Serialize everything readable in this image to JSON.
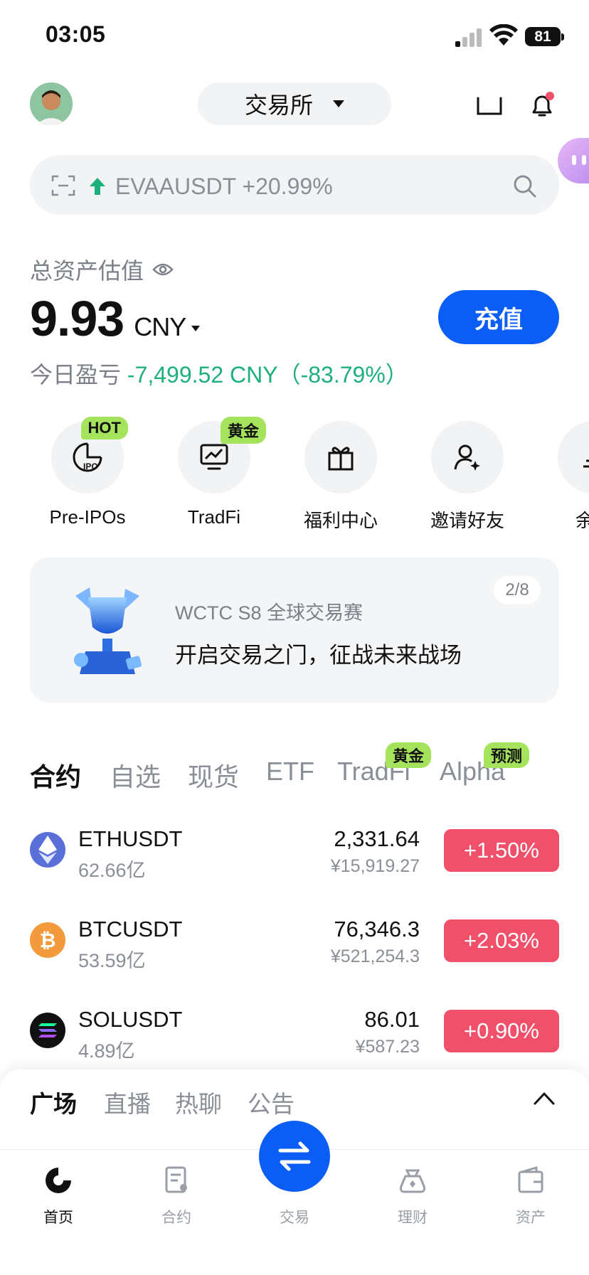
{
  "status_bar": {
    "time": "03:05",
    "battery": "81"
  },
  "header": {
    "exchange_label": "交易所"
  },
  "search": {
    "ticker": "EVAAUSDT +20.99%"
  },
  "assets": {
    "label": "总资产估值",
    "value": "9.93",
    "unit": "CNY",
    "deposit_label": "充值",
    "pnl_label": "今日盈亏",
    "pnl_value": "-7,499.52 CNY（-83.79%）"
  },
  "quick_actions": [
    {
      "label": "Pre-IPOs",
      "badge": "HOT",
      "icon": "pre-ipo-icon"
    },
    {
      "label": "TradFi",
      "badge": "黄金",
      "icon": "chart-monitor-icon"
    },
    {
      "label": "福利中心",
      "badge": "",
      "icon": "gift-icon"
    },
    {
      "label": "邀请好友",
      "badge": "",
      "icon": "invite-user-icon"
    },
    {
      "label": "余币",
      "badge": "",
      "icon": "savings-icon"
    }
  ],
  "banner": {
    "subtitle": "WCTC S8 全球交易赛",
    "title": "开启交易之门，征战未来战场",
    "pager": "2/8"
  },
  "market_tabs": [
    {
      "label": "合约",
      "badge": ""
    },
    {
      "label": "自选",
      "badge": ""
    },
    {
      "label": "现货",
      "badge": ""
    },
    {
      "label": "ETF",
      "badge": ""
    },
    {
      "label": "TradFi",
      "badge": "黄金"
    },
    {
      "label": "Alpha",
      "badge": "预测"
    }
  ],
  "market_rows": [
    {
      "symbol": "ETHUSDT",
      "volume": "62.66亿",
      "price": "2,331.64",
      "price_cny": "¥15,919.27",
      "change": "+1.50%",
      "icon": "eth-icon",
      "color": "#627eea"
    },
    {
      "symbol": "BTCUSDT",
      "volume": "53.59亿",
      "price": "76,346.3",
      "price_cny": "¥521,254.3",
      "change": "+2.03%",
      "icon": "btc-icon",
      "color": "#f7931a"
    },
    {
      "symbol": "SOLUSDT",
      "volume": "4.89亿",
      "price": "86.01",
      "price_cny": "¥587.23",
      "change": "+0.90%",
      "icon": "sol-icon",
      "color": "#111111"
    }
  ],
  "community_tabs": [
    "广场",
    "直播",
    "热聊",
    "公告"
  ],
  "bottom_nav": [
    {
      "label": "首页",
      "icon": "home-icon"
    },
    {
      "label": "合约",
      "icon": "contract-icon"
    },
    {
      "label": "交易",
      "icon": "swap-icon"
    },
    {
      "label": "理财",
      "icon": "earn-icon"
    },
    {
      "label": "资产",
      "icon": "wallet-icon"
    }
  ],
  "colors": {
    "accent": "#0a5ef5",
    "gain_badge": "#f0506a",
    "pnl": "#1db07a",
    "tag": "#a6e35c"
  }
}
